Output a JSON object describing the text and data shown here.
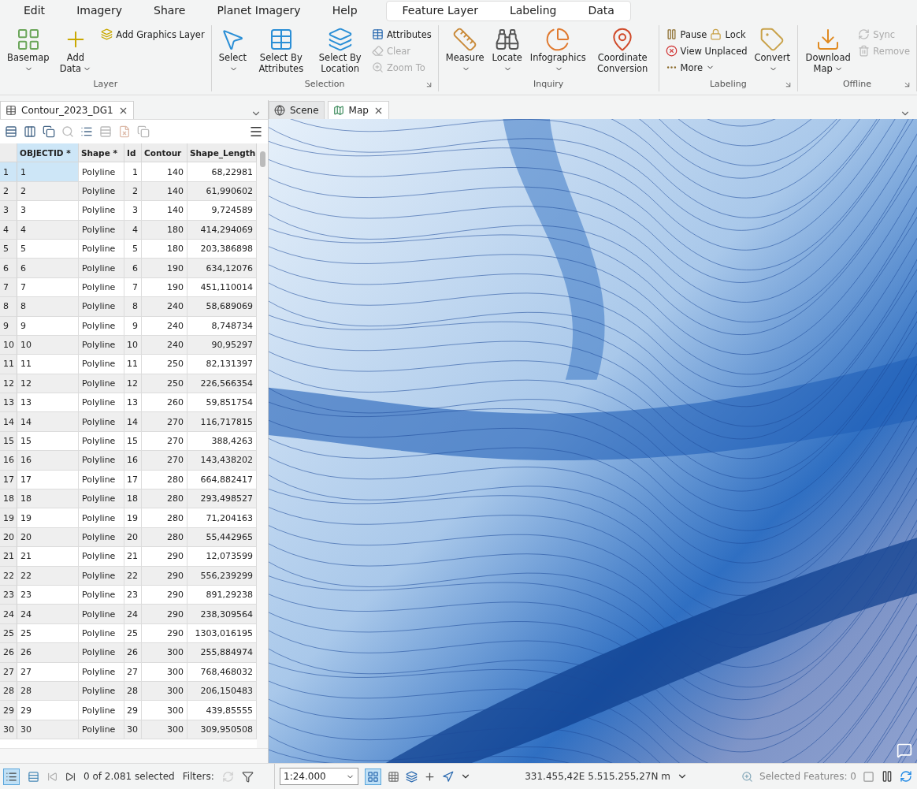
{
  "menu": [
    {
      "label": "Edit",
      "selected": false
    },
    {
      "label": "Imagery",
      "selected": false
    },
    {
      "label": "Share",
      "selected": false
    },
    {
      "label": "Planet Imagery",
      "selected": false
    },
    {
      "label": "Help",
      "selected": false
    }
  ],
  "context_tabs": [
    {
      "label": "Feature Layer",
      "selected": false
    },
    {
      "label": "Labeling",
      "selected": false
    },
    {
      "label": "Data",
      "selected": false
    }
  ],
  "ribbon_groups": [
    {
      "title": "Layer",
      "launcher": false,
      "buttons": [
        {
          "label": "Basemap",
          "kind": "large",
          "dropdown": true,
          "disabled": false
        },
        {
          "label": "Add Data",
          "kind": "large",
          "dropdown": true,
          "disabled": false
        },
        {
          "label": "Add Graphics Layer",
          "kind": "small",
          "dropdown": false,
          "disabled": false
        }
      ]
    },
    {
      "title": "Selection",
      "launcher": true,
      "buttons": [
        {
          "label": "Select",
          "kind": "large",
          "dropdown": true,
          "disabled": false
        },
        {
          "label": "Select By Attributes",
          "kind": "large",
          "dropdown": false,
          "disabled": false
        },
        {
          "label": "Select By Location",
          "kind": "large",
          "dropdown": false,
          "disabled": false
        },
        {
          "label": "Attributes",
          "kind": "small",
          "dropdown": false,
          "disabled": false
        },
        {
          "label": "Clear",
          "kind": "small",
          "dropdown": false,
          "disabled": true
        },
        {
          "label": "Zoom To",
          "kind": "small",
          "dropdown": false,
          "disabled": true
        }
      ]
    },
    {
      "title": "Inquiry",
      "launcher": false,
      "buttons": [
        {
          "label": "Measure",
          "kind": "large",
          "dropdown": true,
          "disabled": false
        },
        {
          "label": "Locate",
          "kind": "large",
          "dropdown": true,
          "disabled": false
        },
        {
          "label": "Infographics",
          "kind": "large",
          "dropdown": true,
          "disabled": false
        },
        {
          "label": "Coordinate Conversion",
          "kind": "large",
          "dropdown": false,
          "disabled": false
        }
      ]
    },
    {
      "title": "Labeling",
      "launcher": true,
      "buttons": [
        {
          "label": "Pause",
          "kind": "small",
          "dropdown": false,
          "disabled": false
        },
        {
          "label": "Lock",
          "kind": "inline",
          "dropdown": false,
          "disabled": false
        },
        {
          "label": "View Unplaced",
          "kind": "small",
          "dropdown": false,
          "disabled": false
        },
        {
          "label": "More",
          "kind": "small",
          "dropdown": true,
          "disabled": false
        },
        {
          "label": "Convert",
          "kind": "large",
          "dropdown": true,
          "disabled": false
        }
      ]
    },
    {
      "title": "Offline",
      "launcher": true,
      "buttons": [
        {
          "label": "Download Map",
          "kind": "large",
          "dropdown": true,
          "disabled": false
        },
        {
          "label": "Sync",
          "kind": "small",
          "dropdown": false,
          "disabled": true
        },
        {
          "label": "Remove",
          "kind": "small",
          "dropdown": false,
          "disabled": true
        }
      ]
    }
  ],
  "table_pane": {
    "tab": "Contour_2023_DG1",
    "columns": [
      "OBJECTID *",
      "Shape *",
      "Id",
      "Contour",
      "Shape_Length"
    ],
    "rows": [
      {
        "n": "1",
        "cells": [
          "1",
          "Polyline",
          "1",
          "140",
          "68,22981"
        ],
        "selected": true
      },
      {
        "n": "2",
        "cells": [
          "2",
          "Polyline",
          "2",
          "140",
          "61,990602"
        ],
        "selected": false
      },
      {
        "n": "3",
        "cells": [
          "3",
          "Polyline",
          "3",
          "140",
          "9,724589"
        ],
        "selected": false
      },
      {
        "n": "4",
        "cells": [
          "4",
          "Polyline",
          "4",
          "180",
          "414,294069"
        ],
        "selected": false
      },
      {
        "n": "5",
        "cells": [
          "5",
          "Polyline",
          "5",
          "180",
          "203,386898"
        ],
        "selected": false
      },
      {
        "n": "6",
        "cells": [
          "6",
          "Polyline",
          "6",
          "190",
          "634,12076"
        ],
        "selected": false
      },
      {
        "n": "7",
        "cells": [
          "7",
          "Polyline",
          "7",
          "190",
          "451,110014"
        ],
        "selected": false
      },
      {
        "n": "8",
        "cells": [
          "8",
          "Polyline",
          "8",
          "240",
          "58,689069"
        ],
        "selected": false
      },
      {
        "n": "9",
        "cells": [
          "9",
          "Polyline",
          "9",
          "240",
          "8,748734"
        ],
        "selected": false
      },
      {
        "n": "10",
        "cells": [
          "10",
          "Polyline",
          "10",
          "240",
          "90,95297"
        ],
        "selected": false
      },
      {
        "n": "11",
        "cells": [
          "11",
          "Polyline",
          "11",
          "250",
          "82,131397"
        ],
        "selected": false
      },
      {
        "n": "12",
        "cells": [
          "12",
          "Polyline",
          "12",
          "250",
          "226,566354"
        ],
        "selected": false
      },
      {
        "n": "13",
        "cells": [
          "13",
          "Polyline",
          "13",
          "260",
          "59,851754"
        ],
        "selected": false
      },
      {
        "n": "14",
        "cells": [
          "14",
          "Polyline",
          "14",
          "270",
          "116,717815"
        ],
        "selected": false
      },
      {
        "n": "15",
        "cells": [
          "15",
          "Polyline",
          "15",
          "270",
          "388,4263"
        ],
        "selected": false
      },
      {
        "n": "16",
        "cells": [
          "16",
          "Polyline",
          "16",
          "270",
          "143,438202"
        ],
        "selected": false
      },
      {
        "n": "17",
        "cells": [
          "17",
          "Polyline",
          "17",
          "280",
          "664,882417"
        ],
        "selected": false
      },
      {
        "n": "18",
        "cells": [
          "18",
          "Polyline",
          "18",
          "280",
          "293,498527"
        ],
        "selected": false
      },
      {
        "n": "19",
        "cells": [
          "19",
          "Polyline",
          "19",
          "280",
          "71,204163"
        ],
        "selected": false
      },
      {
        "n": "20",
        "cells": [
          "20",
          "Polyline",
          "20",
          "280",
          "55,442965"
        ],
        "selected": false
      },
      {
        "n": "21",
        "cells": [
          "21",
          "Polyline",
          "21",
          "290",
          "12,073599"
        ],
        "selected": false
      },
      {
        "n": "22",
        "cells": [
          "22",
          "Polyline",
          "22",
          "290",
          "556,239299"
        ],
        "selected": false
      },
      {
        "n": "23",
        "cells": [
          "23",
          "Polyline",
          "23",
          "290",
          "891,29238"
        ],
        "selected": false
      },
      {
        "n": "24",
        "cells": [
          "24",
          "Polyline",
          "24",
          "290",
          "238,309564"
        ],
        "selected": false
      },
      {
        "n": "25",
        "cells": [
          "25",
          "Polyline",
          "25",
          "290",
          "1303,016195"
        ],
        "selected": false
      },
      {
        "n": "26",
        "cells": [
          "26",
          "Polyline",
          "26",
          "300",
          "255,884974"
        ],
        "selected": false
      },
      {
        "n": "27",
        "cells": [
          "27",
          "Polyline",
          "27",
          "300",
          "768,468032"
        ],
        "selected": false
      },
      {
        "n": "28",
        "cells": [
          "28",
          "Polyline",
          "28",
          "300",
          "206,150483"
        ],
        "selected": false
      },
      {
        "n": "29",
        "cells": [
          "29",
          "Polyline",
          "29",
          "300",
          "439,85555"
        ],
        "selected": false
      },
      {
        "n": "30",
        "cells": [
          "30",
          "Polyline",
          "30",
          "300",
          "309,950508"
        ],
        "selected": false
      }
    ],
    "selection_count": "0 of 2.081 selected",
    "filters_label": "Filters:"
  },
  "map_tabs": [
    {
      "label": "Scene",
      "selected": false,
      "closable": false
    },
    {
      "label": "Map",
      "selected": true,
      "closable": true
    }
  ],
  "map_status": {
    "scale": "1:24.000",
    "coordinates": "331.455,42E 5.515.255,27N m",
    "selected_features": "Selected Features: 0"
  }
}
